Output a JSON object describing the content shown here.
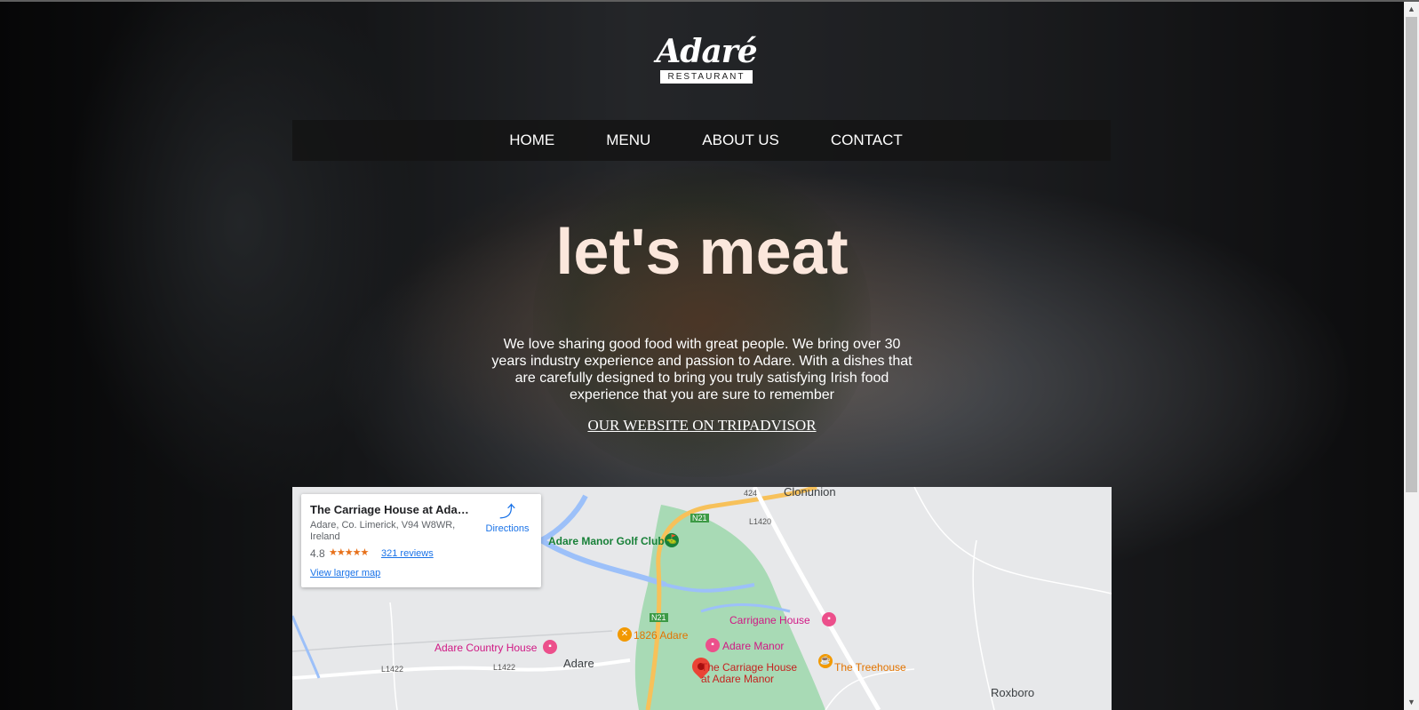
{
  "brand": {
    "script": "Adaré",
    "sub": "RESTAURANT"
  },
  "nav": {
    "items": [
      "HOME",
      "MENU",
      "ABOUT US",
      "CONTACT"
    ]
  },
  "hero": {
    "headline": "let's meat",
    "intro": "We love sharing good food with great people. We bring over 30 years industry experience and passion to Adare. With a dishes that are carefully designed to bring you truly satisfying Irish food experience that you are sure to remember",
    "link": "OUR WEBSITE ON TRIPADVISOR"
  },
  "map": {
    "card": {
      "title": "The Carriage House at Adare ...",
      "address": "Adare, Co. Limerick, V94 W8WR, Ireland",
      "rating": "4.8",
      "stars": "★★★★★",
      "reviews": "321 reviews",
      "larger_map": "View larger map",
      "directions": "Directions"
    },
    "labels": {
      "clonunion": "Clonunion",
      "golf": "Adare Manor Golf Club",
      "n21a": "N21",
      "n21b": "N21",
      "r424": "424",
      "l1420": "L1420",
      "carrigane": "Carrigane House",
      "country": "Adare Country House",
      "r1826": "1826 Adare",
      "manor": "Adare Manor",
      "adare": "Adare",
      "carriage1": "The Carriage House",
      "carriage2": "at Adare Manor",
      "treehouse": "The Treehouse",
      "l1422a": "L1422",
      "l1422b": "L1422",
      "roxboro": "Roxboro"
    }
  },
  "colors": {
    "accent_link": "#1a73e8",
    "headline": "#fbe7dc",
    "park": "#a8dab5"
  }
}
